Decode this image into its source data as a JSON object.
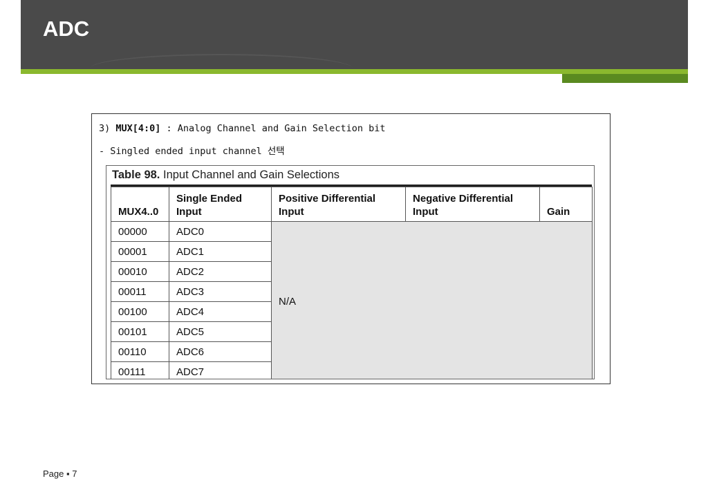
{
  "slide": {
    "title": "ADC",
    "page_label": "Page",
    "page_number": "7"
  },
  "colors": {
    "header_bg": "#4a4a4a",
    "accent_green": "#8ab82e",
    "accent_dark_green": "#5a8a20",
    "na_cell_bg": "#e4e4e4"
  },
  "content": {
    "line1_prefix": "3) ",
    "line1_code": "MUX[4:0]",
    "line1_suffix": " : Analog Channel and Gain Selection bit",
    "line2": "- Singled ended input channel 선택"
  },
  "table": {
    "caption_number": "Table 98.",
    "caption_title": "Input Channel and Gain Selections",
    "headers": [
      "MUX4..0",
      "Single Ended Input",
      "Positive Differential Input",
      "Negative Differential Input",
      "Gain"
    ],
    "rows": [
      [
        "00000",
        "ADC0"
      ],
      [
        "00001",
        "ADC1"
      ],
      [
        "00010",
        "ADC2"
      ],
      [
        "00011",
        "ADC3"
      ],
      [
        "00100",
        "ADC4"
      ],
      [
        "00101",
        "ADC5"
      ],
      [
        "00110",
        "ADC6"
      ],
      [
        "00111",
        "ADC7"
      ]
    ],
    "na_text": "N/A"
  }
}
